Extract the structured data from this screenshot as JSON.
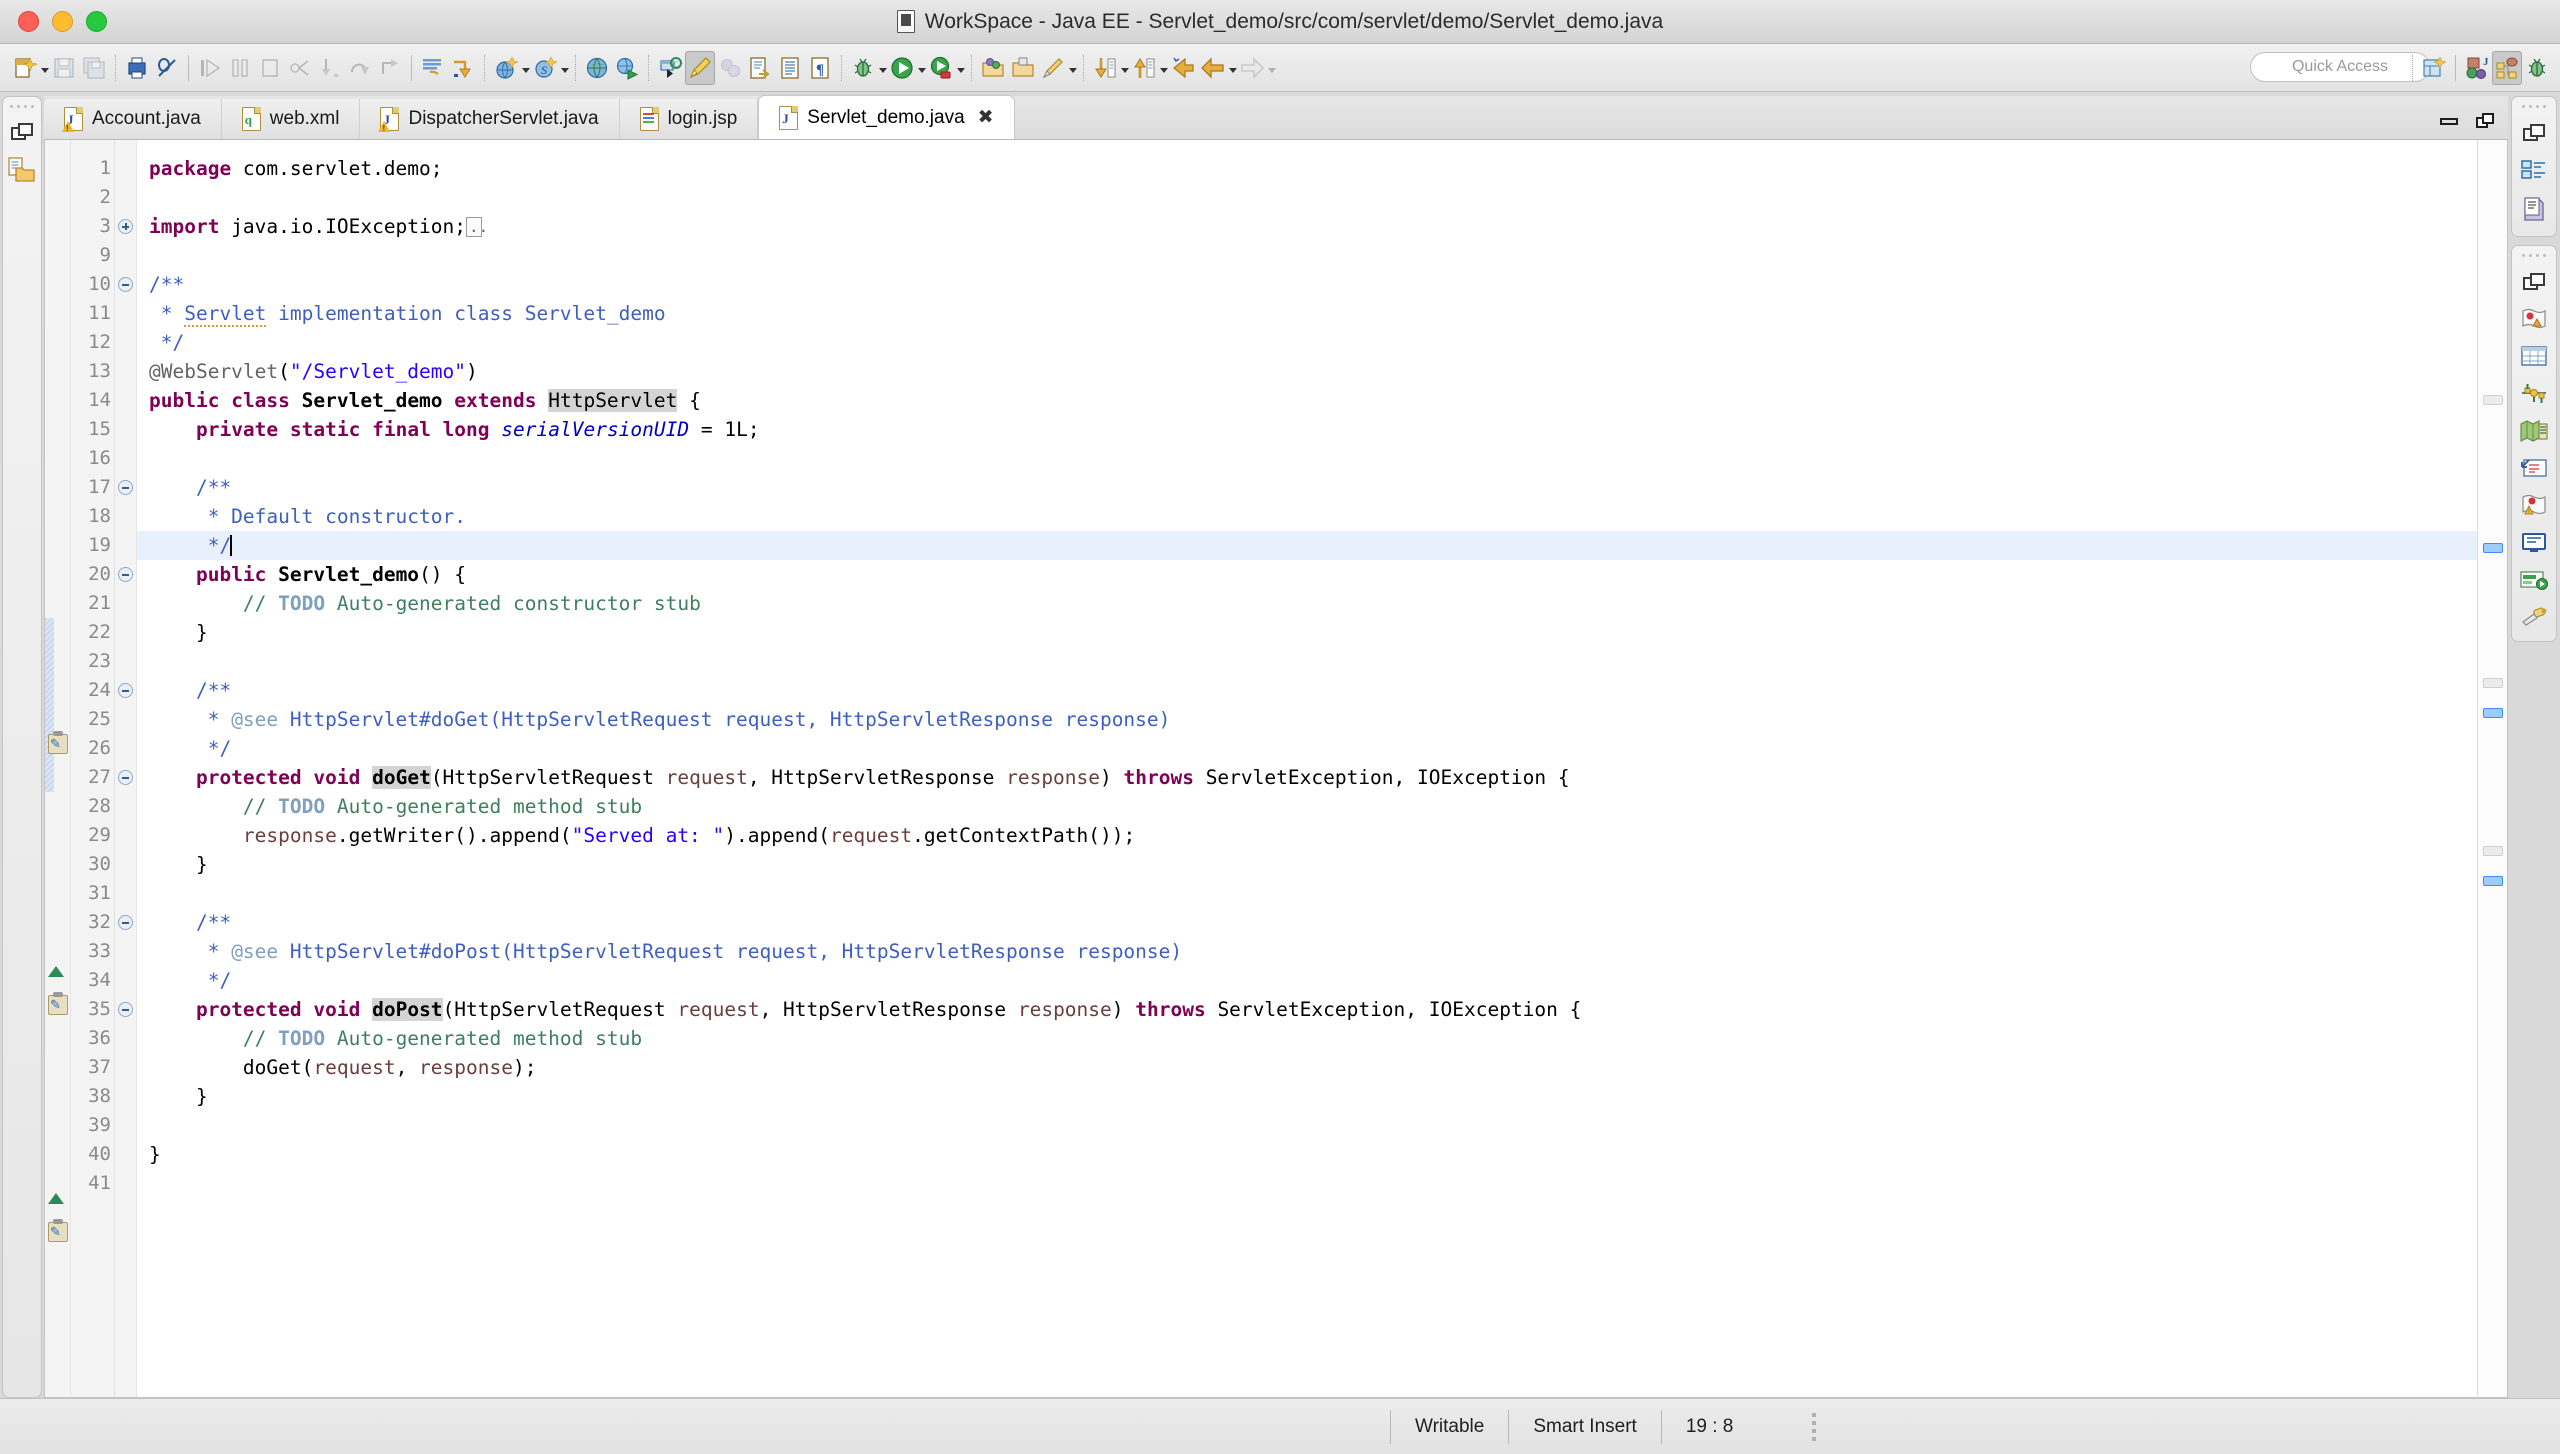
{
  "window": {
    "title": "WorkSpace - Java EE - Servlet_demo/src/com/servlet/demo/Servlet_demo.java",
    "title_icon": "java-file-icon",
    "traffic_lights": [
      "close-button",
      "minimize-button",
      "zoom-button"
    ]
  },
  "toolbar": {
    "quick_access_placeholder": "Quick Access",
    "groups": [
      {
        "name": "new-group",
        "items": [
          {
            "name": "new-wizard-button",
            "icon": "new-file-icon",
            "enabled": true,
            "dropdown": true
          },
          {
            "name": "save-button",
            "icon": "save-icon",
            "enabled": false
          },
          {
            "name": "save-all-button",
            "icon": "save-all-icon",
            "enabled": false
          }
        ]
      },
      {
        "name": "print-group",
        "items": [
          {
            "name": "print-button",
            "icon": "print-icon",
            "enabled": true
          },
          {
            "name": "remove-breakpoints-button",
            "icon": "link-off-icon",
            "enabled": true
          }
        ]
      },
      {
        "name": "debug-control-group",
        "items": [
          {
            "name": "resume-button",
            "icon": "resume-icon",
            "enabled": false
          },
          {
            "name": "suspend-button",
            "icon": "suspend-icon",
            "enabled": false
          },
          {
            "name": "terminate-button",
            "icon": "terminate-icon",
            "enabled": false
          },
          {
            "name": "disconnect-button",
            "icon": "disconnect-icon",
            "enabled": false
          },
          {
            "name": "step-into-button",
            "icon": "step-into-icon",
            "enabled": false
          },
          {
            "name": "step-over-button",
            "icon": "step-over-icon",
            "enabled": false
          },
          {
            "name": "step-return-button",
            "icon": "step-return-icon",
            "enabled": false
          }
        ]
      },
      {
        "name": "marker-group",
        "items": [
          {
            "name": "skip-all-breakpoints-button",
            "icon": "skip-breakpoints-icon",
            "enabled": true
          },
          {
            "name": "next-annotation-button",
            "icon": "next-annotation-icon",
            "enabled": true
          }
        ]
      },
      {
        "name": "web-group",
        "items": [
          {
            "name": "new-dynamic-project-button",
            "icon": "globe-new-icon",
            "enabled": true,
            "dropdown": true
          },
          {
            "name": "new-server-button",
            "icon": "server-new-icon",
            "enabled": true,
            "dropdown": true
          }
        ]
      },
      {
        "name": "browser-group",
        "items": [
          {
            "name": "open-web-browser-button",
            "icon": "globe-icon",
            "enabled": true
          },
          {
            "name": "run-on-server-button",
            "icon": "run-on-server-icon",
            "enabled": true
          }
        ]
      },
      {
        "name": "edit-group",
        "items": [
          {
            "name": "new-java-class-button",
            "icon": "new-class-icon",
            "enabled": true
          },
          {
            "name": "highlight-button",
            "icon": "marker-pen-icon",
            "enabled": true,
            "pressed": true
          },
          {
            "name": "bubbles-button",
            "icon": "bubbles-icon",
            "enabled": false
          },
          {
            "name": "open-task-button",
            "icon": "open-task-icon",
            "enabled": true
          },
          {
            "name": "open-type-button",
            "icon": "open-type-icon",
            "enabled": true
          },
          {
            "name": "show-whitespace-button",
            "icon": "pilcrow-icon",
            "enabled": true
          }
        ]
      },
      {
        "name": "run-debug-group",
        "items": [
          {
            "name": "debug-button",
            "icon": "bug-icon",
            "enabled": true,
            "dropdown": true
          },
          {
            "name": "run-button",
            "icon": "run-icon",
            "enabled": true,
            "dropdown": true
          },
          {
            "name": "run-external-tools-button",
            "icon": "external-tools-icon",
            "enabled": true,
            "dropdown": true
          }
        ]
      },
      {
        "name": "search-group",
        "items": [
          {
            "name": "search-button",
            "icon": "search-folder-icon",
            "enabled": true
          },
          {
            "name": "open-task-folder-button",
            "icon": "task-folder-icon",
            "enabled": true
          },
          {
            "name": "pencil-button",
            "icon": "pencil-icon",
            "enabled": true,
            "dropdown": true
          }
        ]
      },
      {
        "name": "nav-group",
        "items": [
          {
            "name": "next-member-button",
            "icon": "next-member-icon",
            "enabled": true,
            "dropdown": true
          },
          {
            "name": "previous-member-button",
            "icon": "previous-member-icon",
            "enabled": true,
            "dropdown": true
          },
          {
            "name": "last-edit-location-button",
            "icon": "last-edit-icon",
            "enabled": true
          },
          {
            "name": "back-button",
            "icon": "back-arrow-icon",
            "enabled": true,
            "dropdown": true
          },
          {
            "name": "forward-button",
            "icon": "forward-arrow-icon",
            "enabled": false,
            "dropdown": true
          }
        ]
      }
    ],
    "right_items": [
      {
        "name": "new-perspective-button",
        "icon": "new-perspective-icon"
      },
      {
        "name": "perspective-java-ee-button",
        "icon": "java-ee-perspective-icon"
      },
      {
        "name": "perspective-java-button",
        "icon": "java-perspective-icon",
        "pressed": true
      },
      {
        "name": "perspective-debug-button",
        "icon": "debug-perspective-icon"
      }
    ]
  },
  "left_fastview": {
    "items": [
      {
        "name": "restore-view-button",
        "icon": "restore-icon"
      },
      {
        "name": "project-explorer-button",
        "icon": "project-explorer-icon"
      }
    ]
  },
  "right_fastview": {
    "group1": [
      {
        "name": "restore-view-button",
        "icon": "restore-icon"
      },
      {
        "name": "outline-view-button",
        "icon": "outline-icon"
      },
      {
        "name": "task-list-view-button",
        "icon": "task-list-icon"
      }
    ],
    "group2": [
      {
        "name": "restore-view-button-2",
        "icon": "restore-icon"
      },
      {
        "name": "markers-view-button",
        "icon": "markers-icon"
      },
      {
        "name": "properties-view-button",
        "icon": "properties-table-icon"
      },
      {
        "name": "servers-view-button",
        "icon": "servers-icon"
      },
      {
        "name": "data-source-explorer-button",
        "icon": "data-source-icon"
      },
      {
        "name": "snippets-view-button",
        "icon": "snippets-icon"
      },
      {
        "name": "problems-view-button",
        "icon": "problems-icon"
      },
      {
        "name": "console-view-button",
        "icon": "console-icon"
      },
      {
        "name": "progress-view-button",
        "icon": "progress-icon"
      },
      {
        "name": "search-view-button",
        "icon": "search-beam-icon"
      }
    ]
  },
  "editor": {
    "tabs": [
      {
        "name": "tab-account-java",
        "label": "Account.java",
        "icon": "java-warning-file-icon",
        "active": false,
        "closable": false
      },
      {
        "name": "tab-web-xml",
        "label": "web.xml",
        "icon": "xml-file-icon",
        "active": false,
        "closable": false
      },
      {
        "name": "tab-dispatcher-servlet-java",
        "label": "DispatcherServlet.java",
        "icon": "java-warning-file-icon",
        "active": false,
        "closable": false
      },
      {
        "name": "tab-login-jsp",
        "label": "login.jsp",
        "icon": "jsp-file-icon",
        "active": false,
        "closable": false
      },
      {
        "name": "tab-servlet-demo-java",
        "label": "Servlet_demo.java",
        "icon": "java-file-icon",
        "active": true,
        "closable": true,
        "close_glyph": "✖"
      }
    ],
    "minimize_label": "Minimize",
    "maximize_label": "Maximize",
    "line_numbers": [
      1,
      2,
      3,
      9,
      10,
      11,
      12,
      13,
      14,
      15,
      16,
      17,
      18,
      19,
      20,
      21,
      22,
      23,
      24,
      25,
      26,
      27,
      28,
      29,
      30,
      31,
      32,
      33,
      34,
      35,
      36,
      37,
      38,
      39,
      40,
      41
    ],
    "cursor_line": 19,
    "code_lines": [
      {
        "n": 1,
        "text": "package com.servlet.demo;"
      },
      {
        "n": 2,
        "text": ""
      },
      {
        "n": 3,
        "text": "import java.io.IOException;",
        "folded": true
      },
      {
        "n": 9,
        "text": ""
      },
      {
        "n": 10,
        "text": "/**"
      },
      {
        "n": 11,
        "text": " * Servlet implementation class Servlet_demo"
      },
      {
        "n": 12,
        "text": " */"
      },
      {
        "n": 13,
        "text": "@WebServlet(\"/Servlet_demo\")"
      },
      {
        "n": 14,
        "text": "public class Servlet_demo extends HttpServlet {"
      },
      {
        "n": 15,
        "text": "    private static final long serialVersionUID = 1L;"
      },
      {
        "n": 16,
        "text": ""
      },
      {
        "n": 17,
        "text": "    /**"
      },
      {
        "n": 18,
        "text": "     * Default constructor."
      },
      {
        "n": 19,
        "text": "     */"
      },
      {
        "n": 20,
        "text": "    public Servlet_demo() {"
      },
      {
        "n": 21,
        "text": "        // TODO Auto-generated constructor stub"
      },
      {
        "n": 22,
        "text": "    }"
      },
      {
        "n": 23,
        "text": ""
      },
      {
        "n": 24,
        "text": "    /**"
      },
      {
        "n": 25,
        "text": "     * @see HttpServlet#doGet(HttpServletRequest request, HttpServletResponse response)"
      },
      {
        "n": 26,
        "text": "     */"
      },
      {
        "n": 27,
        "text": "    protected void doGet(HttpServletRequest request, HttpServletResponse response) throws ServletException, IOException {"
      },
      {
        "n": 28,
        "text": "        // TODO Auto-generated method stub"
      },
      {
        "n": 29,
        "text": "        response.getWriter().append(\"Served at: \").append(request.getContextPath());"
      },
      {
        "n": 30,
        "text": "    }"
      },
      {
        "n": 31,
        "text": ""
      },
      {
        "n": 32,
        "text": "    /**"
      },
      {
        "n": 33,
        "text": "     * @see HttpServlet#doPost(HttpServletRequest request, HttpServletResponse response)"
      },
      {
        "n": 34,
        "text": "     */"
      },
      {
        "n": 35,
        "text": "    protected void doPost(HttpServletRequest request, HttpServletResponse response) throws ServletException, IOException {"
      },
      {
        "n": 36,
        "text": "        // TODO Auto-generated method stub"
      },
      {
        "n": 37,
        "text": "        doGet(request, response);"
      },
      {
        "n": 38,
        "text": "    }"
      },
      {
        "n": 39,
        "text": ""
      },
      {
        "n": 40,
        "text": "}"
      },
      {
        "n": 41,
        "text": ""
      }
    ],
    "markers": [
      {
        "line": 21,
        "type": "todo-task-marker"
      },
      {
        "line": 27,
        "type": "overrides-method-marker"
      },
      {
        "line": 28,
        "type": "todo-task-marker"
      },
      {
        "line": 35,
        "type": "overrides-method-marker"
      },
      {
        "line": 36,
        "type": "todo-task-marker"
      }
    ]
  },
  "statusbar": {
    "writable": "Writable",
    "insert_mode": "Smart Insert",
    "position": "19 : 8"
  },
  "colors": {
    "keyword": "#7f0055",
    "comment": "#3f7f5f",
    "javadoc": "#3f5fbf",
    "string": "#2a00ff",
    "annotation": "#646464",
    "field": "#0000c0",
    "parameter": "#6a3e3e",
    "highlight_line": "#e8f0fe",
    "occurrence": "#d4d4d4",
    "spell_underline": "#e8922a"
  }
}
